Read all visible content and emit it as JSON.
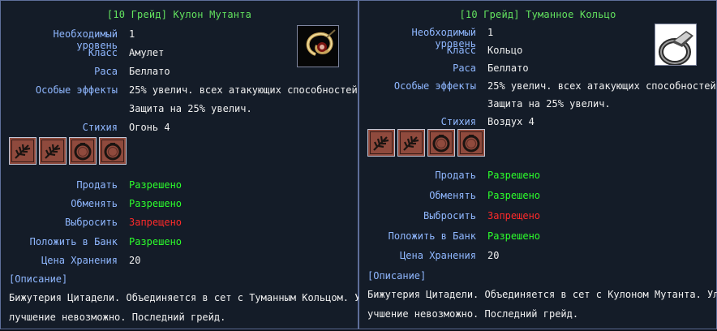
{
  "left": {
    "title": "[10 Грейд] Кулон Мутанта",
    "labels": {
      "level": "Необходимый уровень",
      "class": "Класс",
      "race": "Раса",
      "effects": "Особые эффекты",
      "element": "Стихия",
      "sell": "Продать",
      "trade": "Обменять",
      "drop": "Выбросить",
      "bank": "Положить в Банк",
      "storage": "Цена Хранения"
    },
    "values": {
      "level": "1",
      "class": "Амулет",
      "race": "Беллато",
      "effect_1": "25% увелич. всех атакующих способностей",
      "effect_2": "Защита на 25% увелич.",
      "element": "Огонь 4",
      "sell": "Разрешено",
      "trade": "Разрешено",
      "drop": "Запрещено",
      "bank": "Разрешено",
      "storage": "20"
    },
    "description_header": "[Описание]",
    "description_lines": [
      "Бижутерия Цитадели. Объединяется в сет с Туманным Кольцом. У",
      "лучшение невозможно. Последний грейд."
    ],
    "item_icon": "amulet-icon",
    "set_slots": [
      "branch-icon",
      "branch-icon",
      "ring-icon",
      "ring-icon"
    ]
  },
  "right": {
    "title": "[10 Грейд] Туманное Кольцо",
    "labels": {
      "level": "Необходимый уровень",
      "class": "Класс",
      "race": "Раса",
      "effects": "Особые эффекты",
      "element": "Стихия",
      "sell": "Продать",
      "trade": "Обменять",
      "drop": "Выбросить",
      "bank": "Положить в Банк",
      "storage": "Цена Хранения"
    },
    "values": {
      "level": "1",
      "class": "Кольцо",
      "race": "Беллато",
      "effect_1": "25% увелич. всех атакующих способностей",
      "effect_2": "Защита на 25% увелич.",
      "element": "Воздух 4",
      "sell": "Разрешено",
      "trade": "Разрешено",
      "drop": "Запрещено",
      "bank": "Разрешено",
      "storage": "20"
    },
    "description_header": "[Описание]",
    "description_lines": [
      "Бижутерия Цитадели. Объединяется в сет с Кулоном Мутанта. Ул",
      "учшение невозможно. Последний грейд."
    ],
    "item_icon": "ring-icon",
    "set_slots": [
      "branch-icon",
      "branch-icon",
      "ring-icon",
      "ring-icon"
    ]
  },
  "colors": {
    "title": "#63e35f",
    "label": "#8fb7ff",
    "allowed": "#2cff2c",
    "forbidden": "#ff2a2a",
    "slot_background": "#8f4a3d",
    "panel_background": "#141c28"
  }
}
